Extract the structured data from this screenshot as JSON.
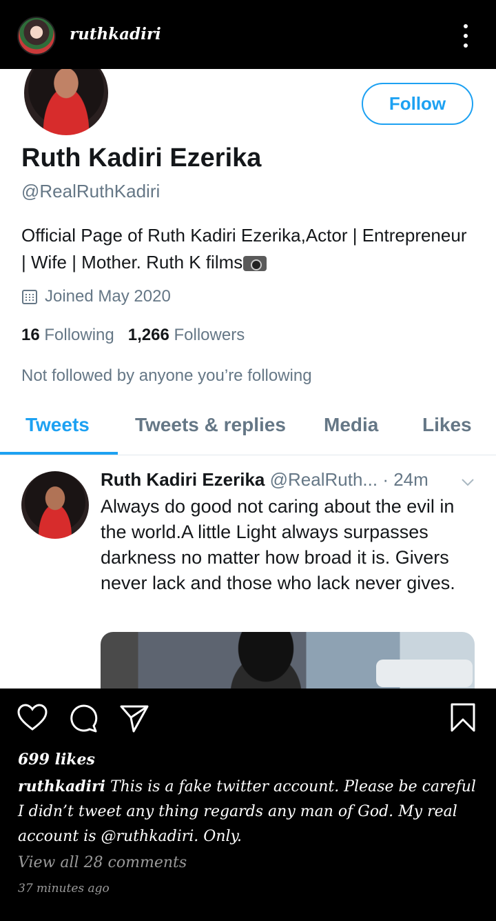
{
  "instagram": {
    "username": "ruthkadiri",
    "likes": "699 likes",
    "caption_user": "ruthkadiri",
    "caption_text": "This is a fake twitter account. Please be careful I didn’t tweet any thing regards any man of God. My real account is @ruthkadiri. Only.",
    "view_comments": "View all 28 comments",
    "timestamp": "37 minutes ago"
  },
  "twitter": {
    "follow_label": "Follow",
    "name": "Ruth Kadiri Ezerika",
    "handle": "@RealRuthKadiri",
    "bio": "Official Page of Ruth Kadiri Ezerika,Actor | Entrepreneur | Wife | Mother. Ruth K films",
    "joined": "Joined May 2020",
    "following_count": "16",
    "following_label": "Following",
    "followers_count": "1,266",
    "followers_label": "Followers",
    "not_followed": "Not followed by anyone you’re following",
    "tabs": [
      {
        "label": "Tweets"
      },
      {
        "label": "Tweets & replies"
      },
      {
        "label": "Media"
      },
      {
        "label": "Likes"
      }
    ],
    "tweet": {
      "author": "Ruth Kadiri Ezerika",
      "meta": "@RealRuth... · 24m",
      "text": "Always do good not caring about the evil in the world.A little Light always surpasses darkness no matter how broad it is. Givers never lack and those who lack never gives."
    }
  },
  "colors": {
    "twitter_blue": "#1da1f2",
    "twitter_gray": "#657786",
    "ig_bg": "#000000"
  }
}
